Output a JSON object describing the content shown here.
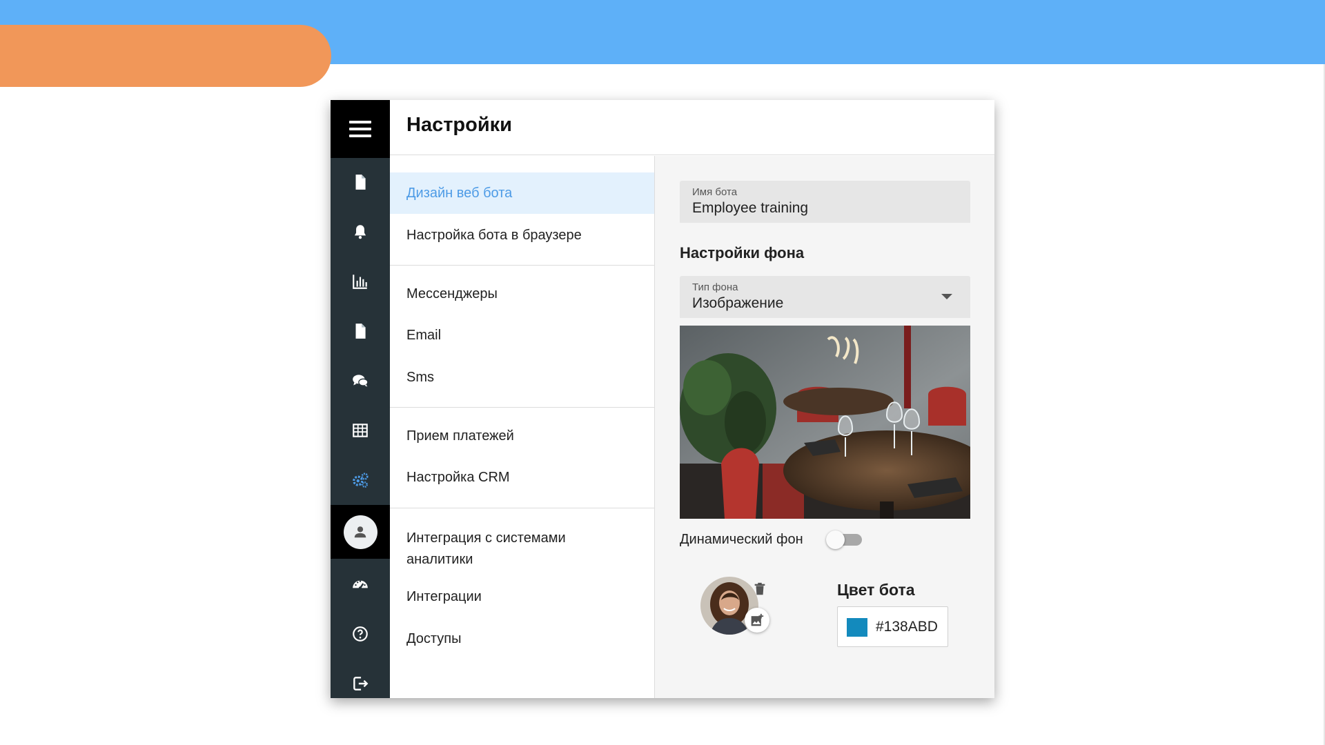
{
  "page": {
    "title": "Настройки"
  },
  "rail": {
    "items": [
      {
        "icon": "hamburger-menu-icon"
      },
      {
        "icon": "document-icon"
      },
      {
        "icon": "bell-icon"
      },
      {
        "icon": "bar-chart-icon"
      },
      {
        "icon": "file-icon"
      },
      {
        "icon": "chat-bubbles-icon"
      },
      {
        "icon": "table-icon"
      },
      {
        "icon": "gears-icon",
        "active": true,
        "color": "#4d9be6"
      },
      {
        "icon": "user-icon"
      },
      {
        "icon": "speedometer-icon"
      },
      {
        "icon": "help-circle-icon"
      },
      {
        "icon": "logout-icon"
      }
    ]
  },
  "menu": {
    "items": [
      {
        "label": "Дизайн веб бота",
        "active": true
      },
      {
        "label": "Настройка бота в браузере"
      },
      {
        "label": "Мессенджеры"
      },
      {
        "label": "Email"
      },
      {
        "label": "Sms"
      },
      {
        "label": "Прием платежей"
      },
      {
        "label": "Настройка CRM"
      },
      {
        "label": "Интеграция с системами аналитики"
      },
      {
        "label": "Интеграции"
      },
      {
        "label": "Доступы"
      }
    ]
  },
  "panel": {
    "bot_name": {
      "label": "Имя бота",
      "value": "Employee training"
    },
    "background_section": "Настройки фона",
    "background_type": {
      "label": "Тип фона",
      "value": "Изображение"
    },
    "dynamic_background": {
      "label": "Динамический фон",
      "enabled": false
    },
    "bot_color": {
      "title": "Цвет бота",
      "hex": "#138ABD"
    }
  },
  "colors": {
    "accent": "#4d9be6",
    "active_menu_bg": "#e3f1fd",
    "rail_bg": "#263238",
    "header_band": "#5eb0f8",
    "orange_accent": "#f19759",
    "bot_color": "#138ABD"
  }
}
